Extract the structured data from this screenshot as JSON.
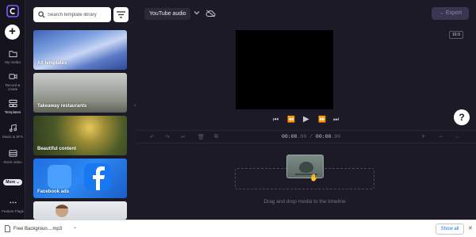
{
  "rail": {
    "items": [
      {
        "label": "My media",
        "icon": "folder-icon"
      },
      {
        "label": "Record & create",
        "icon": "camera-icon"
      },
      {
        "label": "Templates",
        "icon": "templates-icon"
      },
      {
        "label": "Music & SFX",
        "icon": "music-icon"
      },
      {
        "label": "Stock video",
        "icon": "film-icon"
      },
      {
        "label": "Feature Flags",
        "icon": "dots-icon"
      }
    ],
    "more_label": "More"
  },
  "library": {
    "search_placeholder": "Search template library",
    "cards": [
      {
        "title": "All templates"
      },
      {
        "title": "Takeaway restaurants"
      },
      {
        "title": "Beautiful content"
      },
      {
        "title": "Facebook ads"
      },
      {
        "title": ""
      }
    ]
  },
  "topbar": {
    "project_name": "YouTube audio",
    "export_label": "Export"
  },
  "preview": {
    "aspect_ratio": "16:9"
  },
  "timeline": {
    "current_time": "00:00",
    "current_frac": ".00",
    "separator": " / ",
    "total_time": "00:00",
    "total_frac": ".00",
    "drop_text": "Drag and drop media to the timeline"
  },
  "download": {
    "file_name": "Free Backgroun....mp3",
    "show_all_label": "Show all"
  },
  "colors": {
    "accent": "#7b61ff",
    "background": "#1c1a26"
  }
}
